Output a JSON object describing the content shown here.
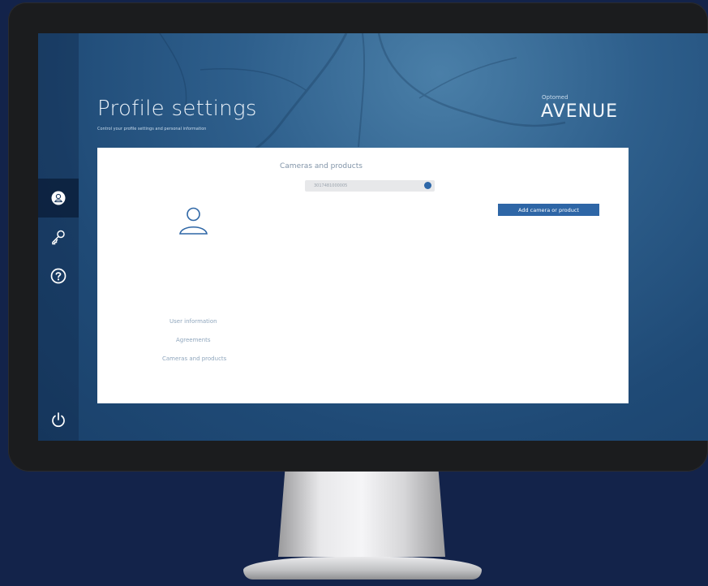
{
  "header": {
    "title": "Profile settings",
    "subtitle": "Control your profile settings and personal information",
    "brand_small": "Optomed",
    "brand": "AVENUE"
  },
  "sidebar": {
    "items": [
      {
        "icon": "user-icon",
        "active": true
      },
      {
        "icon": "key-icon",
        "active": false
      },
      {
        "icon": "help-icon",
        "active": false
      },
      {
        "icon": "power-icon",
        "active": false
      }
    ]
  },
  "profile_nav": {
    "items": [
      {
        "label": "User information"
      },
      {
        "label": "Agreements"
      },
      {
        "label": "Cameras and products"
      }
    ]
  },
  "main": {
    "section_title": "Cameras and products",
    "device_serial": "3017481000005",
    "add_button_label": "Add camera or product"
  },
  "colors": {
    "background": "#13234a",
    "screen": "#2e5f8c",
    "accent": "#2e66a6",
    "panel": "#ffffff"
  }
}
